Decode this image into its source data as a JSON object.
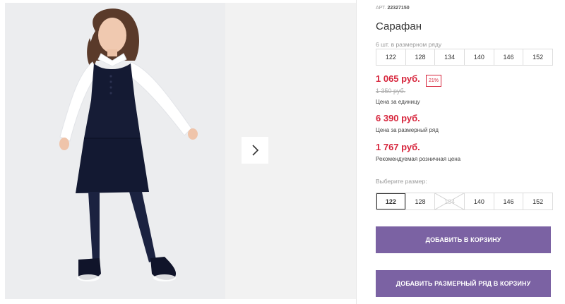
{
  "product": {
    "sku_label": "АРТ.",
    "sku": "22327150",
    "title": "Сарафан"
  },
  "pack": {
    "note": "6 шт. в размерном ряду",
    "sizes": [
      "122",
      "128",
      "134",
      "140",
      "146",
      "152"
    ]
  },
  "prices": {
    "unit_price": "1 065 руб.",
    "discount": "21%",
    "old_price": "1 350 руб.",
    "unit_caption": "Цена за единицу",
    "pack_price": "6 390 руб.",
    "pack_caption": "Цена за размерный ряд",
    "retail_price": "1 767 руб.",
    "retail_caption": "Рекомендуемая розничная цена"
  },
  "size_select": {
    "label": "Выберите размер:",
    "sizes": [
      "122",
      "128",
      "134",
      "140",
      "146",
      "152"
    ],
    "selected": "122",
    "unavailable": "134"
  },
  "buttons": {
    "add_to_cart": "ДОБАВИТЬ В КОРЗИНУ",
    "add_pack_to_cart": "ДОБАВИТЬ РАЗМЕРНЫЙ РЯД В КОРЗИНУ"
  },
  "gallery": {
    "next_icon": "chevron-right-icon"
  },
  "colors": {
    "accent": "#7b62a3",
    "price": "#d7263d"
  }
}
